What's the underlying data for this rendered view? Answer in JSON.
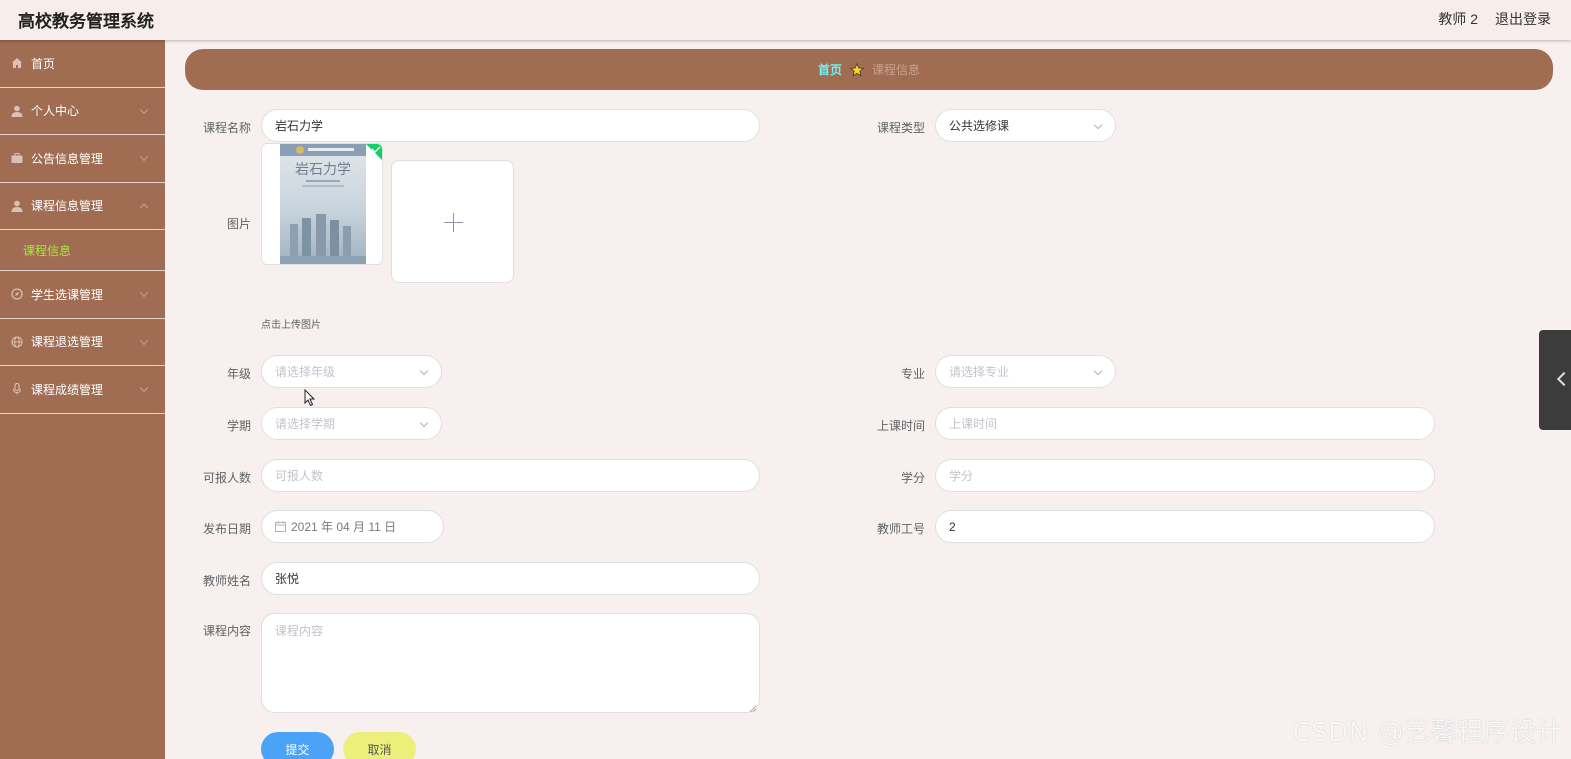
{
  "header": {
    "app_title": "高校教务管理系统",
    "user": "教师 2",
    "logout": "退出登录"
  },
  "sidebar": {
    "items": [
      {
        "label": "首页",
        "icon": "home-icon"
      },
      {
        "label": "个人中心",
        "icon": "user-icon"
      },
      {
        "label": "公告信息管理",
        "icon": "briefcase-icon"
      },
      {
        "label": "课程信息管理",
        "icon": "user-icon"
      },
      {
        "label": "学生选课管理",
        "icon": "compass-icon"
      },
      {
        "label": "课程退选管理",
        "icon": "globe-icon"
      },
      {
        "label": "课程成绩管理",
        "icon": "mic-icon"
      }
    ],
    "submenu": {
      "label": "课程信息"
    }
  },
  "breadcrumb": {
    "home": "首页",
    "current": "课程信息"
  },
  "form": {
    "course_name": {
      "label": "课程名称",
      "value": "岩石力学"
    },
    "course_type": {
      "label": "课程类型",
      "value": "公共选修课"
    },
    "image": {
      "label": "图片",
      "upload_tip": "点击上传图片",
      "book_title": "岩石力学"
    },
    "grade": {
      "label": "年级",
      "placeholder": "请选择年级"
    },
    "major": {
      "label": "专业",
      "placeholder": "请选择专业"
    },
    "semester": {
      "label": "学期",
      "placeholder": "请选择学期"
    },
    "class_time": {
      "label": "上课时间",
      "placeholder": "上课时间"
    },
    "capacity": {
      "label": "可报人数",
      "placeholder": "可报人数"
    },
    "credit": {
      "label": "学分",
      "placeholder": "学分"
    },
    "publish_date": {
      "label": "发布日期",
      "value": "2021 年 04 月 11 日"
    },
    "teacher_id": {
      "label": "教师工号",
      "value": "2"
    },
    "teacher_name": {
      "label": "教师姓名",
      "value": "张悦"
    },
    "course_content": {
      "label": "课程内容",
      "placeholder": "课程内容"
    }
  },
  "buttons": {
    "submit": "提交",
    "cancel": "取消"
  },
  "watermark": "CSDN @艺馨程序设计",
  "colors": {
    "sidebar_bg": "#a06d53",
    "breadcrumb_home": "#6ff1f6",
    "submenu_active": "#a8ea3b",
    "submit_btn": "#4aa3f7",
    "cancel_btn": "#ecf07a"
  }
}
